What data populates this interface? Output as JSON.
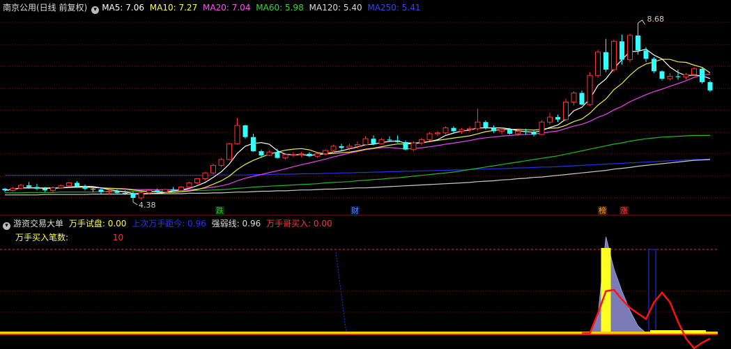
{
  "main_header": {
    "title": "南京公用(日线 前复权)",
    "ma": [
      {
        "label": "MA5: 7.06",
        "color": "#ffffff"
      },
      {
        "label": "MA10: 7.27",
        "color": "#ffff55"
      },
      {
        "label": "MA20: 7.04",
        "color": "#ff55ff"
      },
      {
        "label": "MA60: 5.98",
        "color": "#33dd33"
      },
      {
        "label": "MA120: 5.40",
        "color": "#dddddd"
      },
      {
        "label": "MA250: 5.41",
        "color": "#3344ff"
      }
    ]
  },
  "price_annotations": {
    "high": "8.68",
    "low": "4.38"
  },
  "markers": [
    {
      "label": "跌",
      "color": "#22cc22",
      "bg": "#0a2a0a"
    },
    {
      "label": "财",
      "color": "#5588ff",
      "bg": "#0a1440"
    },
    {
      "label": "榜",
      "color": "#ff9933",
      "bg": "#3a2000"
    },
    {
      "label": "涨",
      "color": "#ff4444",
      "bg": "#3a0a0a"
    }
  ],
  "sub_header": {
    "title": "游资交易大单",
    "items": [
      {
        "label": "万手试盘: 0.00",
        "color": "#ffff44"
      },
      {
        "label": "上次万手距今: 0.96",
        "color": "#2233ff"
      },
      {
        "label": "强弱线: 0.96",
        "color": "#dddddd"
      },
      {
        "label": "万手哥买入: 0.00",
        "color": "#ff3333"
      }
    ],
    "count_label": "万手买入笔数:",
    "count_value": "10"
  },
  "colors": {
    "up": "#ff3333",
    "down": "#33ffff",
    "grid": "#8b0000",
    "bg": "#000000"
  },
  "candles": [
    [
      4.7,
      4.72,
      4.62,
      4.66
    ],
    [
      4.66,
      4.74,
      4.63,
      4.71
    ],
    [
      4.71,
      4.82,
      4.68,
      4.78
    ],
    [
      4.78,
      4.86,
      4.7,
      4.74
    ],
    [
      4.74,
      4.82,
      4.66,
      4.7
    ],
    [
      4.7,
      4.74,
      4.62,
      4.66
    ],
    [
      4.66,
      4.76,
      4.6,
      4.72
    ],
    [
      4.72,
      4.8,
      4.7,
      4.77
    ],
    [
      4.77,
      4.86,
      4.74,
      4.84
    ],
    [
      4.84,
      4.88,
      4.72,
      4.76
    ],
    [
      4.76,
      4.8,
      4.66,
      4.7
    ],
    [
      4.7,
      4.76,
      4.62,
      4.68
    ],
    [
      4.68,
      4.72,
      4.58,
      4.62
    ],
    [
      4.62,
      4.68,
      4.56,
      4.64
    ],
    [
      4.64,
      4.68,
      4.58,
      4.6
    ],
    [
      4.6,
      4.66,
      4.55,
      4.58
    ],
    [
      4.58,
      4.64,
      4.38,
      4.48
    ],
    [
      4.48,
      4.62,
      4.44,
      4.6
    ],
    [
      4.6,
      4.68,
      4.56,
      4.66
    ],
    [
      4.66,
      4.7,
      4.58,
      4.62
    ],
    [
      4.62,
      4.7,
      4.58,
      4.68
    ],
    [
      4.68,
      4.74,
      4.64,
      4.66
    ],
    [
      4.66,
      4.76,
      4.62,
      4.74
    ],
    [
      4.74,
      4.86,
      4.72,
      4.84
    ],
    [
      4.84,
      4.96,
      4.8,
      4.94
    ],
    [
      4.94,
      5.1,
      4.9,
      5.08
    ],
    [
      5.08,
      5.3,
      5.04,
      5.26
    ],
    [
      5.26,
      5.44,
      5.22,
      5.4
    ],
    [
      5.4,
      5.8,
      5.38,
      5.78
    ],
    [
      5.78,
      6.4,
      5.76,
      6.22
    ],
    [
      6.22,
      6.24,
      5.9,
      5.94
    ],
    [
      5.94,
      6.02,
      5.58,
      5.6
    ],
    [
      5.6,
      5.64,
      5.44,
      5.5
    ],
    [
      5.5,
      5.62,
      5.48,
      5.58
    ],
    [
      5.58,
      5.66,
      5.42,
      5.44
    ],
    [
      5.44,
      5.56,
      5.4,
      5.52
    ],
    [
      5.52,
      5.58,
      5.46,
      5.52
    ],
    [
      5.52,
      5.58,
      5.46,
      5.54
    ],
    [
      5.54,
      5.58,
      5.46,
      5.48
    ],
    [
      5.48,
      5.56,
      5.44,
      5.54
    ],
    [
      5.54,
      5.64,
      5.5,
      5.62
    ],
    [
      5.62,
      5.76,
      5.56,
      5.72
    ],
    [
      5.72,
      5.78,
      5.62,
      5.68
    ],
    [
      5.68,
      5.78,
      5.62,
      5.72
    ],
    [
      5.72,
      5.84,
      5.66,
      5.76
    ],
    [
      5.76,
      5.96,
      5.74,
      5.9
    ],
    [
      5.9,
      5.98,
      5.74,
      5.78
    ],
    [
      5.78,
      5.92,
      5.76,
      5.88
    ],
    [
      5.88,
      5.96,
      5.82,
      5.86
    ],
    [
      5.86,
      5.98,
      5.8,
      5.82
    ],
    [
      5.82,
      5.86,
      5.62,
      5.64
    ],
    [
      5.64,
      5.84,
      5.6,
      5.8
    ],
    [
      5.8,
      5.92,
      5.74,
      5.88
    ],
    [
      5.88,
      6.06,
      5.84,
      6.02
    ],
    [
      6.02,
      6.08,
      5.96,
      6.04
    ],
    [
      6.04,
      6.2,
      6.0,
      6.16
    ],
    [
      6.16,
      6.2,
      6.04,
      6.08
    ],
    [
      6.08,
      6.16,
      6.02,
      6.12
    ],
    [
      6.12,
      6.2,
      6.06,
      6.14
    ],
    [
      6.14,
      6.62,
      6.1,
      6.3
    ],
    [
      6.3,
      6.34,
      6.12,
      6.16
    ],
    [
      6.16,
      6.22,
      6.04,
      6.08
    ],
    [
      6.08,
      6.18,
      6.0,
      6.12
    ],
    [
      6.12,
      6.16,
      6.0,
      6.02
    ],
    [
      6.02,
      6.12,
      5.96,
      6.08
    ],
    [
      6.08,
      6.14,
      6.0,
      6.06
    ],
    [
      6.06,
      6.12,
      5.96,
      6.0
    ],
    [
      6.0,
      6.34,
      5.98,
      6.3
    ],
    [
      6.3,
      6.52,
      6.24,
      6.42
    ],
    [
      6.42,
      6.48,
      6.3,
      6.36
    ],
    [
      6.36,
      6.86,
      6.32,
      6.78
    ],
    [
      6.78,
      7.04,
      6.7,
      7.0
    ],
    [
      7.0,
      7.06,
      6.7,
      6.72
    ],
    [
      6.72,
      7.5,
      6.68,
      7.42
    ],
    [
      7.42,
      8.04,
      7.36,
      7.98
    ],
    [
      7.98,
      8.3,
      7.5,
      7.56
    ],
    [
      7.56,
      8.28,
      7.5,
      8.24
    ],
    [
      8.24,
      8.4,
      7.68,
      7.8
    ],
    [
      7.8,
      8.42,
      7.74,
      8.38
    ],
    [
      8.38,
      8.68,
      7.92,
      8.02
    ],
    [
      8.02,
      8.1,
      7.74,
      7.82
    ],
    [
      7.82,
      7.86,
      7.48,
      7.52
    ],
    [
      7.52,
      7.54,
      7.3,
      7.34
    ],
    [
      7.34,
      7.48,
      7.3,
      7.4
    ],
    [
      7.4,
      7.56,
      7.32,
      7.38
    ],
    [
      7.38,
      7.48,
      7.32,
      7.44
    ],
    [
      7.44,
      7.62,
      7.4,
      7.58
    ],
    [
      7.58,
      7.6,
      7.22,
      7.26
    ],
    [
      7.26,
      7.3,
      7.02,
      7.06
    ]
  ],
  "ma_values": {
    "ma60": [
      4.6,
      4.6,
      4.6,
      4.61,
      4.61,
      4.61,
      4.61,
      4.62,
      4.62,
      4.62,
      4.62,
      4.62,
      4.63,
      4.63,
      4.63,
      4.63,
      4.63,
      4.63,
      4.64,
      4.64,
      4.64,
      4.65,
      4.65,
      4.65,
      4.66,
      4.66,
      4.67,
      4.68,
      4.69,
      4.71,
      4.72,
      4.74,
      4.75,
      4.76,
      4.77,
      4.78,
      4.79,
      4.8,
      4.81,
      4.82,
      4.84,
      4.85,
      4.86,
      4.87,
      4.89,
      4.9,
      4.92,
      4.93,
      4.95,
      4.96,
      4.98,
      5.0,
      5.02,
      5.04,
      5.06,
      5.08,
      5.1,
      5.13,
      5.16,
      5.19,
      5.22,
      5.25,
      5.28,
      5.31,
      5.34,
      5.37,
      5.4,
      5.43,
      5.46,
      5.49,
      5.53,
      5.57,
      5.61,
      5.65,
      5.69,
      5.73,
      5.77,
      5.8,
      5.84,
      5.87,
      5.9,
      5.92,
      5.94,
      5.95,
      5.96,
      5.97,
      5.98,
      5.98,
      5.98
    ],
    "ma120": [
      4.55,
      4.55,
      4.55,
      4.55,
      4.55,
      4.56,
      4.56,
      4.56,
      4.56,
      4.56,
      4.56,
      4.57,
      4.57,
      4.57,
      4.57,
      4.57,
      4.57,
      4.57,
      4.58,
      4.58,
      4.58,
      4.58,
      4.58,
      4.59,
      4.59,
      4.59,
      4.6,
      4.6,
      4.61,
      4.62,
      4.62,
      4.63,
      4.64,
      4.64,
      4.65,
      4.65,
      4.66,
      4.67,
      4.67,
      4.68,
      4.69,
      4.69,
      4.7,
      4.71,
      4.72,
      4.72,
      4.73,
      4.74,
      4.75,
      4.76,
      4.77,
      4.78,
      4.79,
      4.8,
      4.81,
      4.82,
      4.83,
      4.84,
      4.85,
      4.87,
      4.88,
      4.89,
      4.91,
      4.92,
      4.94,
      4.95,
      4.97,
      4.98,
      5.0,
      5.02,
      5.04,
      5.06,
      5.08,
      5.1,
      5.12,
      5.14,
      5.17,
      5.19,
      5.21,
      5.24,
      5.26,
      5.28,
      5.3,
      5.32,
      5.34,
      5.36,
      5.38,
      5.39,
      5.4
    ],
    "ma250": [
      5.02,
      5.02,
      5.02,
      5.02,
      5.02,
      5.02,
      5.02,
      5.02,
      5.02,
      5.02,
      5.02,
      5.02,
      5.02,
      5.02,
      5.02,
      5.02,
      5.02,
      5.02,
      5.02,
      5.02,
      5.02,
      5.02,
      5.02,
      5.02,
      5.02,
      5.02,
      5.03,
      5.03,
      5.03,
      5.03,
      5.03,
      5.04,
      5.04,
      5.04,
      5.05,
      5.05,
      5.05,
      5.06,
      5.06,
      5.06,
      5.07,
      5.07,
      5.08,
      5.08,
      5.09,
      5.09,
      5.1,
      5.1,
      5.11,
      5.11,
      5.12,
      5.12,
      5.13,
      5.13,
      5.14,
      5.14,
      5.15,
      5.15,
      5.16,
      5.17,
      5.17,
      5.18,
      5.18,
      5.19,
      5.2,
      5.2,
      5.21,
      5.22,
      5.22,
      5.23,
      5.24,
      5.25,
      5.26,
      5.27,
      5.28,
      5.29,
      5.3,
      5.31,
      5.32,
      5.33,
      5.34,
      5.35,
      5.36,
      5.37,
      5.38,
      5.39,
      5.4,
      5.4,
      5.41
    ]
  },
  "indicator": {
    "strong_line": [
      0,
      0,
      0,
      0,
      0,
      0,
      0,
      0,
      0,
      0,
      0,
      0,
      0,
      0,
      0,
      0,
      0,
      0,
      0,
      0,
      0,
      0,
      0,
      0,
      0,
      0,
      0,
      0,
      0,
      0,
      0,
      0,
      0,
      0,
      0,
      0,
      0,
      0,
      0,
      0,
      0,
      0,
      0,
      0,
      0,
      0,
      0,
      0,
      0,
      0,
      0,
      0,
      0,
      0,
      0,
      0,
      0,
      0,
      0,
      0,
      0,
      0,
      0,
      0,
      0,
      0,
      0,
      0,
      0,
      0,
      0,
      0,
      0,
      0,
      0.7,
      1.5,
      1.55,
      1.2,
      0.9,
      0.7,
      0.5,
      1.1,
      1.45,
      1.1,
      0.4,
      -0.2,
      -0.55,
      -0.35,
      -0.2
    ],
    "volume_area": [
      0,
      0,
      0,
      0,
      0,
      0,
      0,
      0,
      0,
      0,
      0,
      0,
      0,
      0,
      0,
      0,
      0,
      0,
      0,
      0,
      0,
      0,
      0,
      0,
      0,
      0,
      0,
      0,
      0,
      0,
      0,
      0,
      0,
      0,
      0,
      0,
      0,
      0,
      0,
      0,
      0,
      0,
      0,
      0,
      0,
      0,
      0,
      0,
      0,
      0,
      0,
      0,
      0,
      0,
      0,
      0,
      0,
      0,
      0,
      0,
      0,
      0,
      0,
      0,
      0,
      0,
      0,
      0,
      0,
      0,
      0,
      0,
      0,
      0,
      0.6,
      3.45,
      2.3,
      1.5,
      0.8,
      0.25,
      0,
      0,
      0,
      0,
      0,
      0,
      0,
      0,
      0
    ],
    "yellow_bar_index": 75,
    "last_signal_index": 30,
    "dashed_level": 3.0
  }
}
